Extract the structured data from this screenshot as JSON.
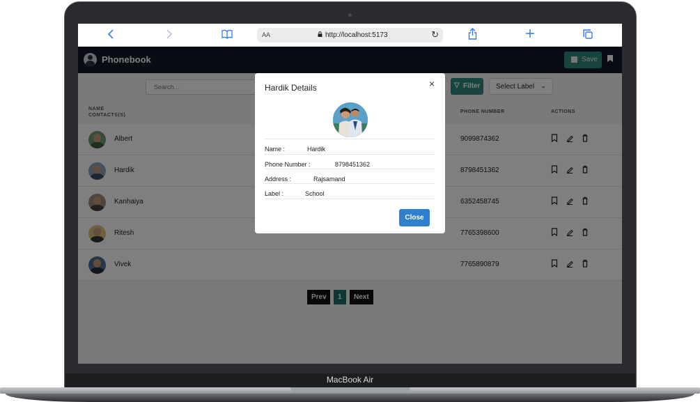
{
  "device": {
    "model_label": "MacBook Air"
  },
  "browser": {
    "text_size_label": "AA",
    "url": "http://localhost:5173",
    "icons": {
      "back": "chevron-left-icon",
      "forward": "chevron-right-icon",
      "bookmarks": "book-icon",
      "reload": "reload-icon",
      "share": "share-icon",
      "new_tab": "plus-icon",
      "tabs": "tabs-icon"
    }
  },
  "header": {
    "title": "Phonebook",
    "save_label": "Save",
    "accent": "#2f8a7c",
    "background": "#131a26"
  },
  "toolbar": {
    "search_placeholder": "Search...",
    "filter_label": "Filter",
    "select_label": "Select Label"
  },
  "table": {
    "headers": {
      "name": "NAME",
      "contacts": "CONTACTS(S)",
      "phone": "PHONE NUMBER",
      "actions": "ACTIONS"
    },
    "rows": [
      {
        "name": "Albert",
        "phone": "9099874362"
      },
      {
        "name": "Hardik",
        "phone": "8798451362"
      },
      {
        "name": "Kanhaiya",
        "phone": "6352458745"
      },
      {
        "name": "Ritesh",
        "phone": "7765398600"
      },
      {
        "name": "Vivek",
        "phone": "7765890879"
      }
    ]
  },
  "pagination": {
    "prev": "Prev",
    "page": "1",
    "next": "Next"
  },
  "modal": {
    "title": "Hardik Details",
    "close_x": "×",
    "name_label": "Name :",
    "name_value": "Hardik",
    "phone_label": "Phone Number :",
    "phone_value": "8798451362",
    "address_label": "Address :",
    "address_value": "Rajsamand",
    "label_label": "Label :",
    "label_value": "School",
    "close_button": "Close",
    "close_color": "#2f7fcf"
  }
}
